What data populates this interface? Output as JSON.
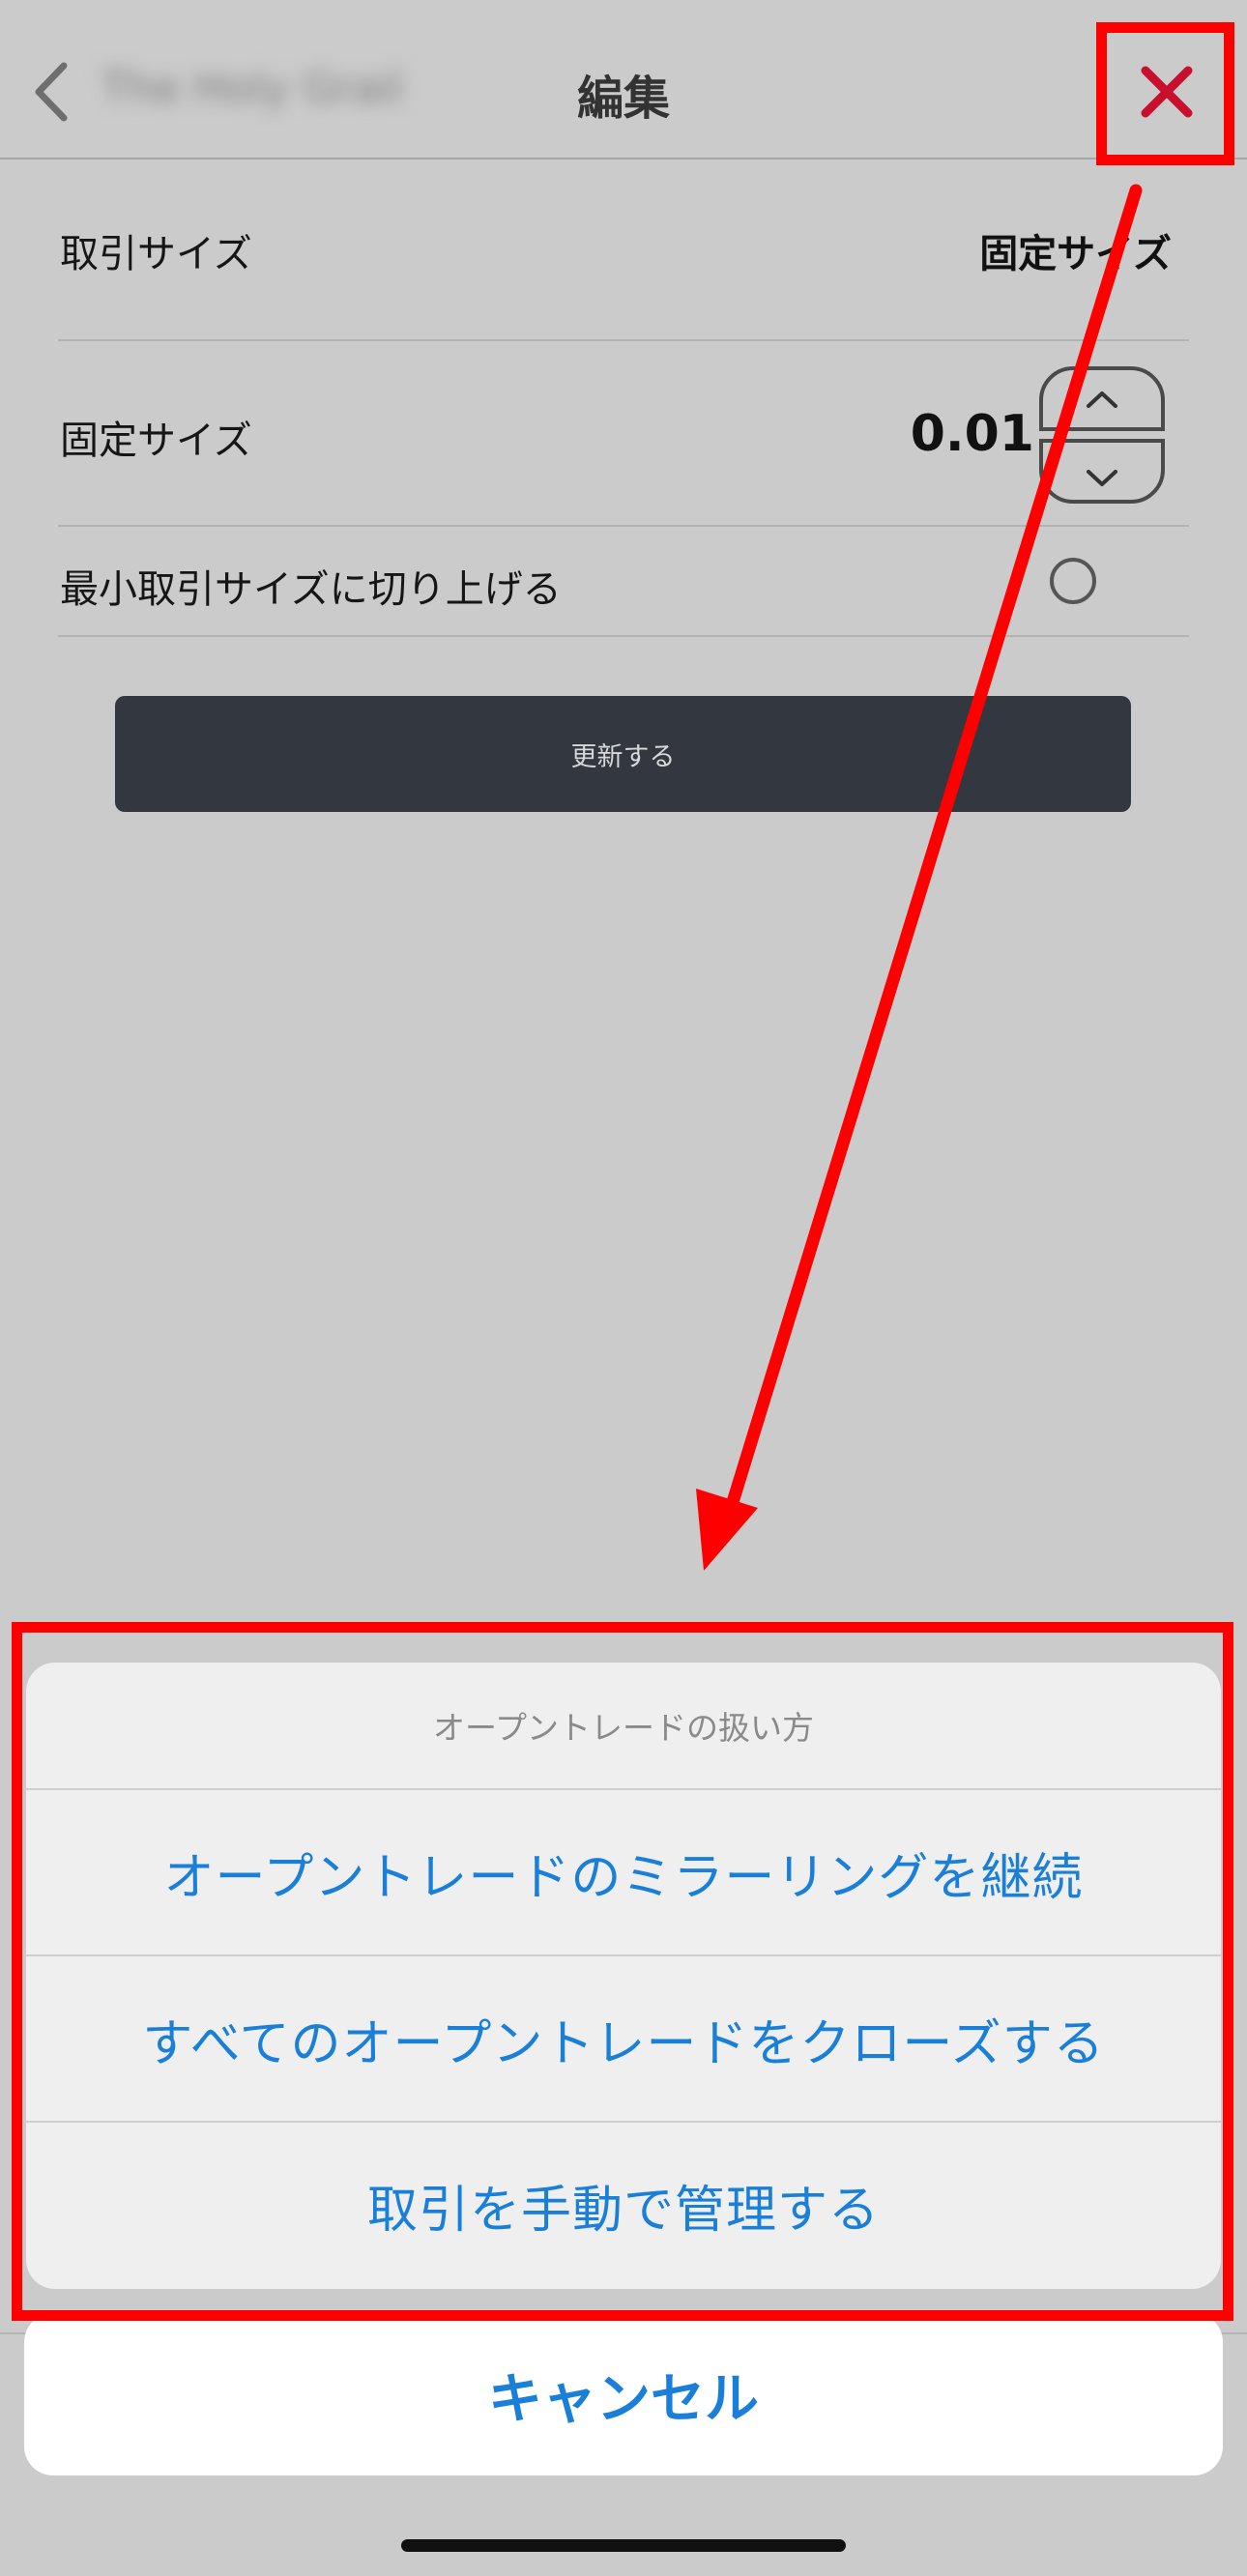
{
  "header": {
    "back_icon": "chevron-left-icon",
    "previous_title": "The Holy Grail",
    "title": "編集",
    "close_icon": "close-x-icon"
  },
  "settings": {
    "trade_size": {
      "label": "取引サイズ",
      "value": "固定サイズ"
    },
    "fixed_size": {
      "label": "固定サイズ",
      "value": "0.01",
      "increment_icon": "chevron-up-icon",
      "decrement_icon": "chevron-down-icon"
    },
    "round_up": {
      "label": "最小取引サイズに切り上げる",
      "checked": false
    },
    "update_button": "更新する"
  },
  "action_sheet": {
    "title": "オープントレードの扱い方",
    "options": [
      "オープントレードのミラーリングを継続",
      "すべてのオープントレードをクローズする",
      "取引を手動で管理する"
    ],
    "cancel": "キャンセル"
  },
  "colors": {
    "background_dimmed": "#cbcbcb",
    "action_text": "#1a7fd9",
    "annotation": "#ff0000",
    "button_dark": "#333740"
  }
}
